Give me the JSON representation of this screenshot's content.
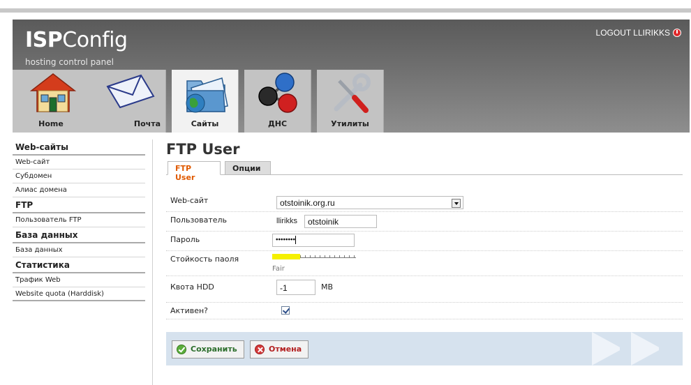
{
  "app": {
    "logo_bold": "ISP",
    "logo_rest": "Config",
    "tagline": "hosting control panel",
    "logout": "LOGOUT LLIRIKKS"
  },
  "tabs": [
    {
      "label": "Home",
      "icon": "house-icon"
    },
    {
      "label": "Почта",
      "icon": "envelope-icon"
    },
    {
      "label": "Сайты",
      "icon": "folder-globe-icon",
      "active": true
    },
    {
      "label": "ДНС",
      "icon": "network-nodes-icon"
    },
    {
      "label": "Утилиты",
      "icon": "tools-icon"
    }
  ],
  "sidebar": {
    "groups": [
      {
        "title": "Web-сайты",
        "items": [
          "Web-сайт",
          "Субдомен",
          "Алиас домена"
        ]
      },
      {
        "title": "FTP",
        "items": [
          "Пользователь FTP"
        ]
      },
      {
        "title": "База данных",
        "items": [
          "База данных"
        ]
      },
      {
        "title": "Статистика",
        "items": [
          "Трафик Web",
          "Website quota (Harddisk)"
        ]
      }
    ]
  },
  "form": {
    "title": "FTP User",
    "tabs": [
      "FTP User",
      "Опции"
    ],
    "fields": {
      "website_label": "Web-сайт",
      "website_value": "otstoinik.org.ru",
      "user_label": "Пользователь",
      "user_prefix": "llirikks",
      "user_value": "otstoinik",
      "password_label": "Пароль",
      "password_value": "••••••••",
      "strength_label": "Стойкость паоля",
      "strength_text": "Fair",
      "strength_level": 0.33,
      "quota_label": "Квота HDD",
      "quota_value": "-1",
      "quota_unit": "MB",
      "active_label": "Активен?",
      "active_checked": true
    },
    "buttons": {
      "save": "Сохранить",
      "cancel": "Отмена"
    }
  },
  "colors": {
    "accent": "#e05a00",
    "strength": "#f5f000",
    "buttonbar": "#d6e2ee"
  }
}
